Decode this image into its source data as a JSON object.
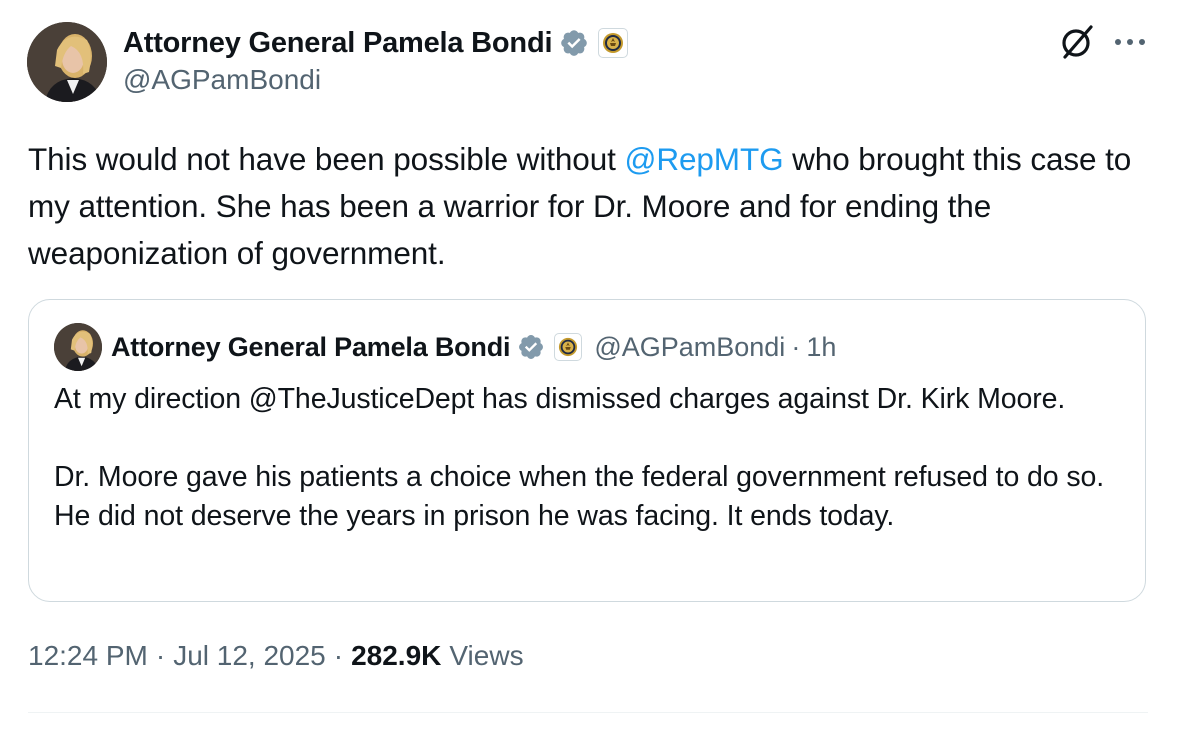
{
  "author": {
    "display_name": "Attorney General Pamela Bondi",
    "handle": "@AGPamBondi",
    "avatar_icon": "profile-photo",
    "verified_icon": "verified-gray-badge-icon",
    "affiliation_icon": "doj-seal-icon"
  },
  "header_actions": {
    "grok_icon": "grok-icon",
    "more_icon": "more-icon"
  },
  "tweet": {
    "text_before": "This would not have been possible without ",
    "mention": "@RepMTG",
    "text_after": " who brought this case to my attention. She has been a warrior for Dr. Moore and for ending the weaponization of government."
  },
  "quote": {
    "display_name": "Attorney General Pamela Bondi",
    "handle": "@AGPamBondi",
    "separator": "·",
    "time": "1h",
    "paragraph_1": "At my direction @TheJusticeDept has dismissed charges against Dr. Kirk Moore.",
    "paragraph_2": "Dr. Moore gave his patients a choice when the federal government refused to do so. He did not deserve the years in prison he was facing. It ends today."
  },
  "meta": {
    "time": "12:24 PM",
    "date": "Jul 12, 2025",
    "separator": "·",
    "views_count": "282.9K",
    "views_label": "Views"
  },
  "colors": {
    "text": "#0f1419",
    "secondary": "#536471",
    "link": "#1d9bf0",
    "border": "#cfd9de",
    "verified_badge": "#829aab",
    "seal_gold": "#c49a2c"
  }
}
